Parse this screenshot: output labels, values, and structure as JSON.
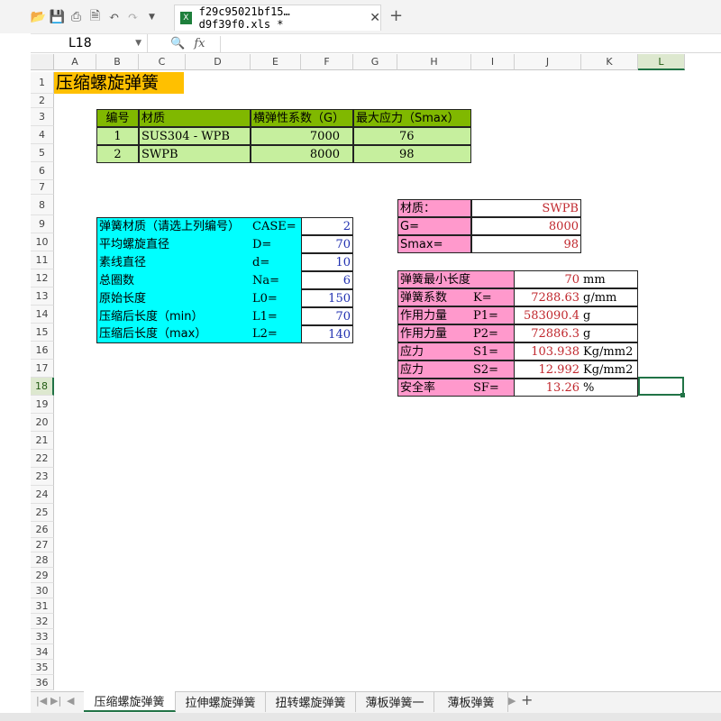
{
  "window": {
    "file_tab_label": "f29c95021bf15…d9f39f0.xls *",
    "file_tab_close": "✕",
    "new_tab": "+"
  },
  "toolbar": {
    "icons": [
      "open-folder-icon",
      "save-icon",
      "print-icon",
      "print-preview-icon",
      "undo-icon",
      "redo-icon",
      "dropdown-icon"
    ]
  },
  "formula_bar": {
    "name_box": "L18",
    "fx": "fx",
    "formula": ""
  },
  "columns": [
    "A",
    "B",
    "C",
    "D",
    "E",
    "F",
    "G",
    "H",
    "I",
    "J",
    "K",
    "L"
  ],
  "selected_column": "L",
  "rows": [
    "1",
    "2",
    "3",
    "4",
    "5",
    "6",
    "7",
    "8",
    "9",
    "10",
    "11",
    "12",
    "13",
    "14",
    "15",
    "16",
    "17",
    "18",
    "19",
    "20",
    "21",
    "22",
    "23",
    "24",
    "25",
    "26",
    "27",
    "28",
    "29",
    "30",
    "31",
    "32",
    "33",
    "34",
    "35",
    "36"
  ],
  "selected_row": "18",
  "sheet": {
    "title": "压缩螺旋弹簧",
    "material_table": {
      "headers": [
        "编号",
        "材质",
        "横弹性系数（G）",
        "最大应力（Smax）"
      ],
      "rows": [
        [
          "1",
          "SUS304 - WPB",
          "7000",
          "76"
        ],
        [
          "2",
          "SWPB",
          "8000",
          "98"
        ]
      ]
    },
    "inputs": {
      "rows": [
        {
          "label": "弹簧材质（请选上列编号）",
          "sym": "CASE=",
          "value": "2"
        },
        {
          "label": "平均螺旋直径",
          "sym": "D=",
          "value": "70"
        },
        {
          "label": "素线直径",
          "sym": "d=",
          "value": "10"
        },
        {
          "label": "总圈数",
          "sym": "Na=",
          "value": "6"
        },
        {
          "label": "原始长度",
          "sym": "L0=",
          "value": "150"
        },
        {
          "label": "压缩后长度（min）",
          "sym": "L1=",
          "value": "70"
        },
        {
          "label": "压缩后长度（max）",
          "sym": "L2=",
          "value": "140"
        }
      ]
    },
    "selected_material": {
      "rows": [
        {
          "label": "材质：",
          "value": "SWPB"
        },
        {
          "label": "G=",
          "value": "8000"
        },
        {
          "label": "Smax=",
          "value": "98"
        }
      ]
    },
    "results": {
      "rows": [
        {
          "label": "弹簧最小长度",
          "sym": "",
          "value": "70",
          "unit": "mm"
        },
        {
          "label": "弹簧系数",
          "sym": "K=",
          "value": "7288.63",
          "unit": "g/mm"
        },
        {
          "label": "作用力量",
          "sym": "P1=",
          "value": "583090.4",
          "unit": "g"
        },
        {
          "label": "作用力量",
          "sym": "P2=",
          "value": "72886.3",
          "unit": "g"
        },
        {
          "label": "应力",
          "sym": "S1=",
          "value": "103.938",
          "unit": "Kg/mm2"
        },
        {
          "label": "应力",
          "sym": "S2=",
          "value": "12.992",
          "unit": "Kg/mm2"
        },
        {
          "label": "安全率",
          "sym": "SF=",
          "value": "13.26",
          "unit": "%"
        }
      ]
    }
  },
  "sheet_tabs": [
    {
      "label": "压缩螺旋弹簧",
      "active": true
    },
    {
      "label": "拉伸螺旋弹簧",
      "active": false
    },
    {
      "label": "扭转螺旋弹簧",
      "active": false
    },
    {
      "label": "薄板弹簧一",
      "active": false
    },
    {
      "label": "薄板弹簧",
      "active": false
    }
  ],
  "sheet_nav": [
    "|◀",
    "▶|",
    "◀",
    "▶"
  ],
  "add_sheet": "+"
}
